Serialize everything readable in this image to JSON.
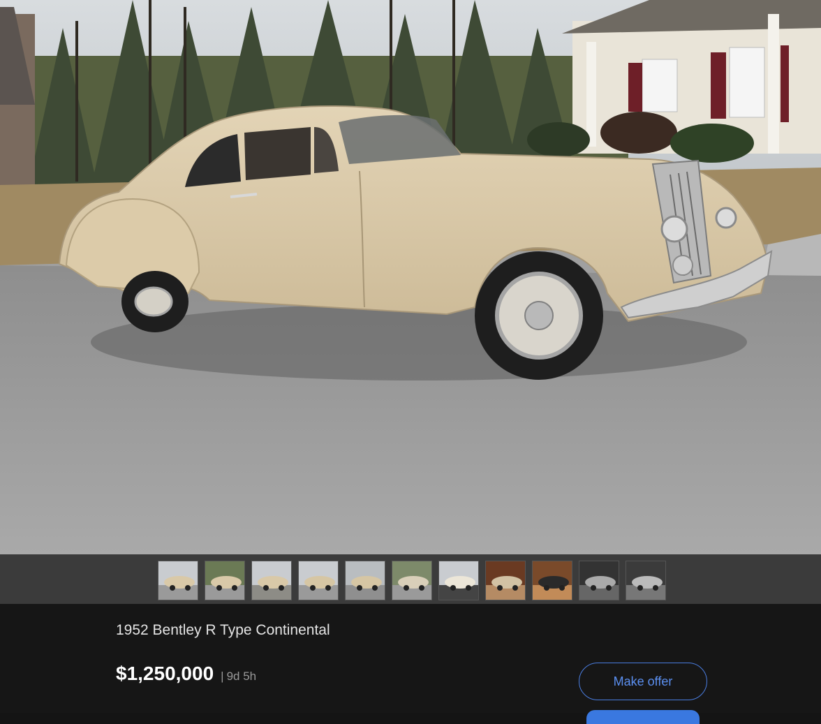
{
  "hero": {
    "image": "1952 Bentley R Type Continental photo, cream coupe parked on gravel street"
  },
  "thumbnails": [
    {
      "kind": "car-side"
    },
    {
      "kind": "car-side-person"
    },
    {
      "kind": "car-far"
    },
    {
      "kind": "car-rear-quarter"
    },
    {
      "kind": "car-rear"
    },
    {
      "kind": "car-front"
    },
    {
      "kind": "car-rear-close"
    },
    {
      "kind": "interior-seats"
    },
    {
      "kind": "interior-dash"
    },
    {
      "kind": "engine"
    },
    {
      "kind": "engine-side"
    }
  ],
  "listing": {
    "title": "1952 Bentley R Type Continental",
    "price": "$1,250,000",
    "separator": "|",
    "time_left": "9d 5h"
  },
  "actions": {
    "make_offer_label": "Make offer"
  },
  "colors": {
    "accent": "#4a7de0",
    "background": "#161616",
    "strip": "#3b3b3b"
  }
}
